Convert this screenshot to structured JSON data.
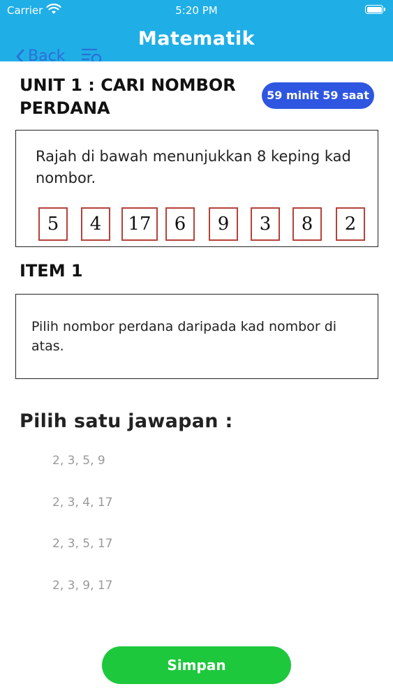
{
  "status_bar": {
    "carrier": "Carrier",
    "time": "5:20 PM"
  },
  "nav": {
    "title": "Matematik",
    "back_label": "Back"
  },
  "unit": {
    "title": "UNIT 1 : CARI NOMBOR PERDANA",
    "timer": "59 minit 59 saat"
  },
  "question": {
    "text": "Rajah di bawah menunjukkan 8 keping kad nombor.",
    "cards": [
      "5",
      "4",
      "17",
      "6",
      "9",
      "3",
      "8",
      "2"
    ]
  },
  "item": {
    "title": "ITEM 1",
    "text": "Pilih nombor perdana daripada kad nombor di atas."
  },
  "answers": {
    "prompt": "Pilih satu jawapan :",
    "options": [
      "2, 3, 5, 9",
      "2, 3, 4, 17",
      "2, 3, 5, 17",
      "2, 3, 9, 17"
    ]
  },
  "footer": {
    "save_label": "Simpan"
  },
  "colors": {
    "header": "#1faee6",
    "timer": "#2f56e0",
    "save": "#1ec83c",
    "card_border": "#b5423b"
  }
}
